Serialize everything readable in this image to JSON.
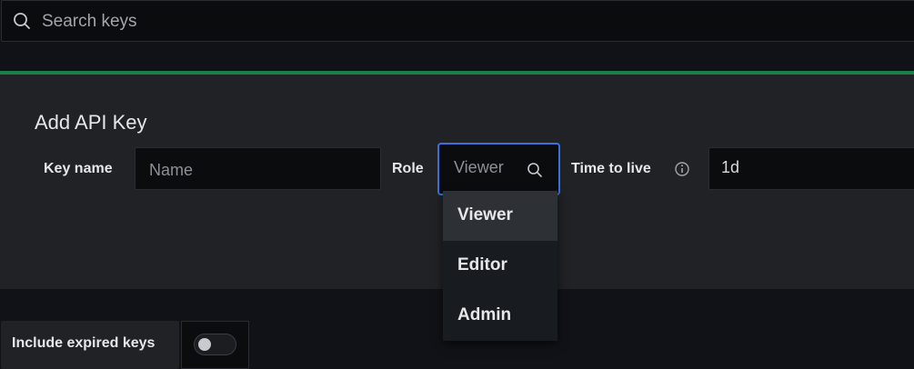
{
  "search": {
    "placeholder": "Search keys",
    "icon": "search-icon"
  },
  "form": {
    "title": "Add API Key",
    "key_name_label": "Key name",
    "key_name_placeholder": "Name",
    "role_label": "Role",
    "role_value": "Viewer",
    "ttl_label": "Time to live",
    "ttl_value": "1d"
  },
  "role_options": [
    "Viewer",
    "Editor",
    "Admin"
  ],
  "footer": {
    "include_expired_label": "Include expired keys",
    "include_expired_on": false
  },
  "colors": {
    "accent": "#3871dc",
    "success_line": "#1a7f4b",
    "panel": "#202226",
    "background": "#111217"
  }
}
